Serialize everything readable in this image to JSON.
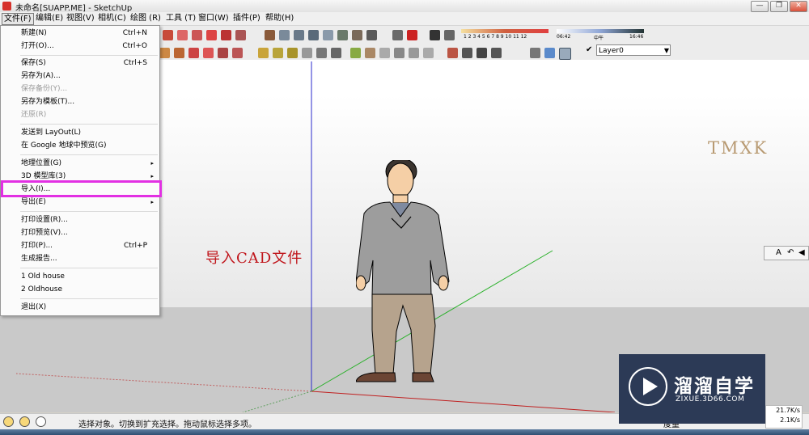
{
  "window": {
    "title": "未命名[SUAPP.ME] - SketchUp",
    "controls": [
      "—",
      "❐",
      "✕"
    ]
  },
  "menubar": [
    {
      "label": "文件(F)",
      "active": true
    },
    {
      "label": "编辑(E)"
    },
    {
      "label": "视图(V)"
    },
    {
      "label": "相机(C)"
    },
    {
      "label": "绘图 (R)"
    },
    {
      "label": "工具 (T)"
    },
    {
      "label": "窗口(W)"
    },
    {
      "label": "插件(P)"
    },
    {
      "label": "帮助(H)"
    }
  ],
  "file_menu": {
    "items": [
      {
        "label": "新建(N)",
        "shortcut": "Ctrl+N"
      },
      {
        "label": "打开(O)...",
        "shortcut": "Ctrl+O"
      },
      {
        "label": "保存(S)",
        "shortcut": "Ctrl+S"
      },
      {
        "label": "另存为(A)..."
      },
      {
        "label": "保存备份(Y)...",
        "disabled": true
      },
      {
        "label": "另存为模板(T)..."
      },
      {
        "label": "还原(R)",
        "disabled": true
      },
      {
        "label": "发送到 LayOut(L)"
      },
      {
        "label": "在 Google 地球中预览(G)"
      },
      {
        "label": "地理位置(G)",
        "submenu": true
      },
      {
        "label": "3D 模型库(3)",
        "submenu": true
      },
      {
        "label": "导入(I)...",
        "highlighted": true
      },
      {
        "label": "导出(E)",
        "submenu": true
      },
      {
        "label": "打印设置(R)..."
      },
      {
        "label": "打印预览(V)..."
      },
      {
        "label": "打印(P)...",
        "shortcut": "Ctrl+P"
      },
      {
        "label": "生成报告..."
      },
      {
        "label": "1 Old  house"
      },
      {
        "label": "2 Oldhouse"
      },
      {
        "label": "退出(X)"
      }
    ],
    "submenu_arrow": "▸"
  },
  "toolbar": {
    "shadow_months": "1 2 3 4 5 6 7 8 9 10 11 12",
    "shadow_times": {
      "start": "06:42",
      "mid": "中午",
      "end": "16:46"
    },
    "layer": "Layer0"
  },
  "canvas": {
    "watermark": "TMXK",
    "caption": "导入CAD文件"
  },
  "side_panel": {
    "labels": [
      "A",
      "↶",
      "◀"
    ]
  },
  "statusbar": {
    "text": "选择对象。切换到扩充选择。拖动鼠标选择多项。",
    "right_label": "度量"
  },
  "network": {
    "up": "21.7K/s",
    "down": "2.1K/s"
  },
  "brand": {
    "name": "溜溜自学",
    "url": "ZIXUE.3D66.COM"
  },
  "colors": {
    "highlight": "#e230e3",
    "caption": "#c0151b",
    "axis_blue": "#2020c0",
    "axis_green": "#20a020",
    "axis_red": "#c02020"
  }
}
